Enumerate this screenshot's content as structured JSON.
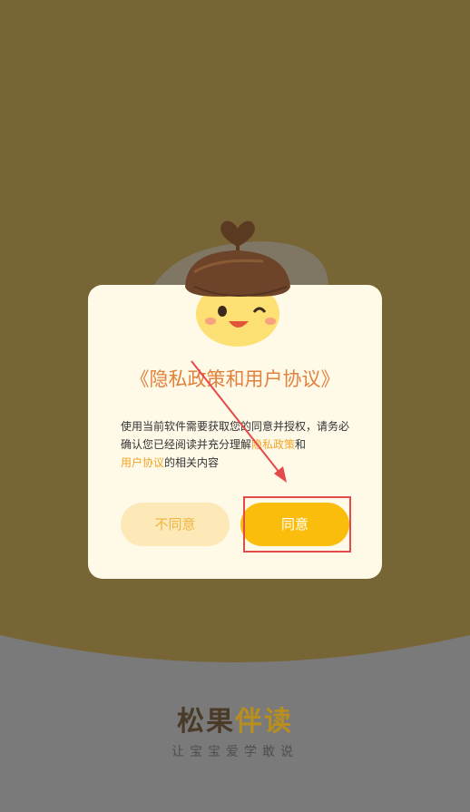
{
  "dialog": {
    "title": "《隐私政策和用户协议》",
    "body_prefix": "使用当前软件需要获取您的同意并授权，请务必确认您已经阅读并充分理解",
    "privacy_link": "隐私政策",
    "conjunction": "和",
    "user_agreement_link": "用户协议",
    "body_suffix": "的相关内容",
    "disagree_label": "不同意",
    "agree_label": "同意"
  },
  "brand": {
    "title_part1": "松果",
    "title_part2": "伴读",
    "slogan": "让宝宝爱学敢说"
  },
  "colors": {
    "top_background": "#776535",
    "bottom_background": "#7a7a7a",
    "dialog_background": "#fff9e8",
    "title_color": "#e0813d",
    "link_color": "#f2a528",
    "agree_button": "#fbbd0c",
    "disagree_button": "#fde9b8",
    "annotation_red": "#e54a4a"
  },
  "icons": {
    "mascot": "acorn-mascot-icon",
    "annotation_arrow": "red-arrow-icon"
  }
}
